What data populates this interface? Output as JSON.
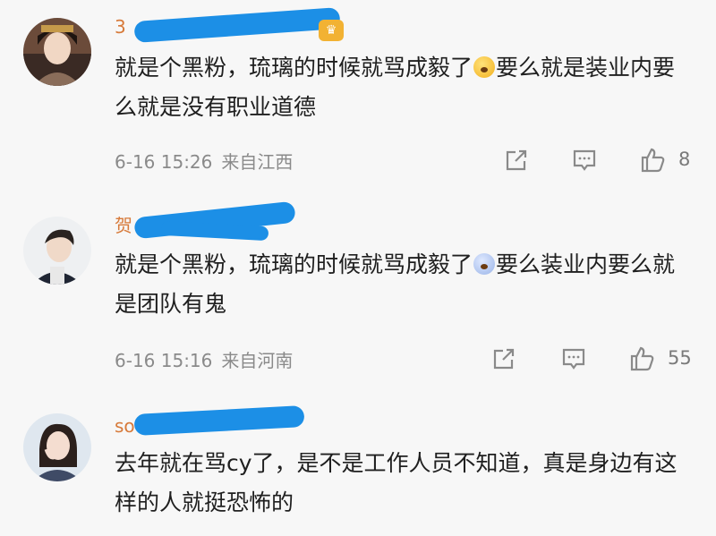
{
  "comments": [
    {
      "username": "3",
      "text_before": "就是个黑粉，琉璃的时候就骂成毅了",
      "text_after": "要么就是装业内要么就是没有职业道德",
      "date": "6-16 15:26",
      "location": "来自江西",
      "likes": "8"
    },
    {
      "username": "贺",
      "text_before": "就是个黑粉，琉璃的时候就骂成毅了",
      "text_after": "要么装业内要么就是团队有鬼",
      "date": "6-16 15:16",
      "location": "来自河南",
      "likes": "55"
    },
    {
      "username": "so",
      "text": "去年就在骂cy了，是不是工作人员不知道，真是身边有这样的人就挺恐怖的"
    }
  ],
  "icons": {
    "share": "share-icon",
    "reply": "comment-icon",
    "like": "thumbs-up-icon",
    "emoji1": "scared-face-emoji",
    "emoji2": "screaming-face-emoji"
  },
  "colors": {
    "redaction": "#1c8fe6",
    "username": "#d77a3a",
    "meta": "#8a8a8a"
  }
}
